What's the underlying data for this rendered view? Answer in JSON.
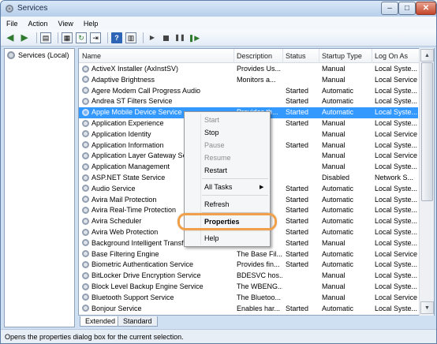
{
  "window": {
    "title": "Services"
  },
  "menu": [
    "File",
    "Action",
    "View",
    "Help"
  ],
  "tree": {
    "root_label": "Services (Local)"
  },
  "columns": [
    "Name",
    "Description",
    "Status",
    "Startup Type",
    "Log On As"
  ],
  "rows": [
    {
      "name": "ActiveX Installer (AxInstSV)",
      "desc": "Provides Us...",
      "status": "",
      "startup": "Manual",
      "logon": "Local Syste..."
    },
    {
      "name": "Adaptive Brightness",
      "desc": "Monitors a...",
      "status": "",
      "startup": "Manual",
      "logon": "Local Service"
    },
    {
      "name": "Agere Modem Call Progress Audio",
      "desc": "",
      "status": "Started",
      "startup": "Automatic",
      "logon": "Local Syste..."
    },
    {
      "name": "Andrea ST Filters Service",
      "desc": "",
      "status": "Started",
      "startup": "Automatic",
      "logon": "Local Syste..."
    },
    {
      "name": "Apple Mobile Device Service",
      "desc": "Provides th...",
      "status": "Started",
      "startup": "Automatic",
      "logon": "Local Syste..."
    },
    {
      "name": "Application Experience",
      "desc": "",
      "status": "Started",
      "startup": "Manual",
      "logon": "Local Syste..."
    },
    {
      "name": "Application Identity",
      "desc": "",
      "status": "",
      "startup": "Manual",
      "logon": "Local Service"
    },
    {
      "name": "Application Information",
      "desc": "",
      "status": "Started",
      "startup": "Manual",
      "logon": "Local Syste..."
    },
    {
      "name": "Application Layer Gateway Service",
      "desc": "",
      "status": "",
      "startup": "Manual",
      "logon": "Local Service"
    },
    {
      "name": "Application Management",
      "desc": "",
      "status": "",
      "startup": "Manual",
      "logon": "Local Syste..."
    },
    {
      "name": "ASP.NET State Service",
      "desc": "",
      "status": "",
      "startup": "Disabled",
      "logon": "Network S..."
    },
    {
      "name": "Audio Service",
      "desc": "",
      "status": "Started",
      "startup": "Automatic",
      "logon": "Local Syste..."
    },
    {
      "name": "Avira Mail Protection",
      "desc": "",
      "status": "Started",
      "startup": "Automatic",
      "logon": "Local Syste..."
    },
    {
      "name": "Avira Real-Time Protection",
      "desc": "",
      "status": "Started",
      "startup": "Automatic",
      "logon": "Local Syste..."
    },
    {
      "name": "Avira Scheduler",
      "desc": "",
      "status": "Started",
      "startup": "Automatic",
      "logon": "Local Syste..."
    },
    {
      "name": "Avira Web Protection",
      "desc": "",
      "status": "Started",
      "startup": "Automatic",
      "logon": "Local Syste..."
    },
    {
      "name": "Background Intelligent Transfer Service",
      "desc": "",
      "status": "Started",
      "startup": "Manual",
      "logon": "Local Syste..."
    },
    {
      "name": "Base Filtering Engine",
      "desc": "The Base Fil...",
      "status": "Started",
      "startup": "Automatic",
      "logon": "Local Service"
    },
    {
      "name": "Biometric Authentication Service",
      "desc": "Provides fin...",
      "status": "Started",
      "startup": "Automatic",
      "logon": "Local Syste..."
    },
    {
      "name": "BitLocker Drive Encryption Service",
      "desc": "BDESVC hos...",
      "status": "",
      "startup": "Manual",
      "logon": "Local Syste..."
    },
    {
      "name": "Block Level Backup Engine Service",
      "desc": "The WBENG...",
      "status": "",
      "startup": "Manual",
      "logon": "Local Syste..."
    },
    {
      "name": "Bluetooth Support Service",
      "desc": "The Bluetoo...",
      "status": "",
      "startup": "Manual",
      "logon": "Local Service"
    },
    {
      "name": "Bonjour Service",
      "desc": "Enables har...",
      "status": "Started",
      "startup": "Automatic",
      "logon": "Local Syste..."
    }
  ],
  "selected_row": "Apple Mobile Device Service",
  "context_menu": {
    "start": "Start",
    "stop": "Stop",
    "pause": "Pause",
    "resume": "Resume",
    "restart": "Restart",
    "all_tasks": "All Tasks",
    "refresh": "Refresh",
    "properties": "Properties",
    "help": "Help"
  },
  "tabs": [
    "Extended",
    "Standard"
  ],
  "status_bar": "Opens the properties dialog box for the current selection.",
  "colors": {
    "selection": "#3399ff",
    "highlight_ring": "#f0a04a"
  },
  "icons": [
    "services-icon",
    "back-arrow-icon",
    "forward-arrow-icon",
    "console-tree-icon",
    "export-icon",
    "refresh-icon",
    "help-icon",
    "play-icon",
    "stop-icon",
    "pause-icon",
    "restart-icon",
    "gear-icon"
  ]
}
